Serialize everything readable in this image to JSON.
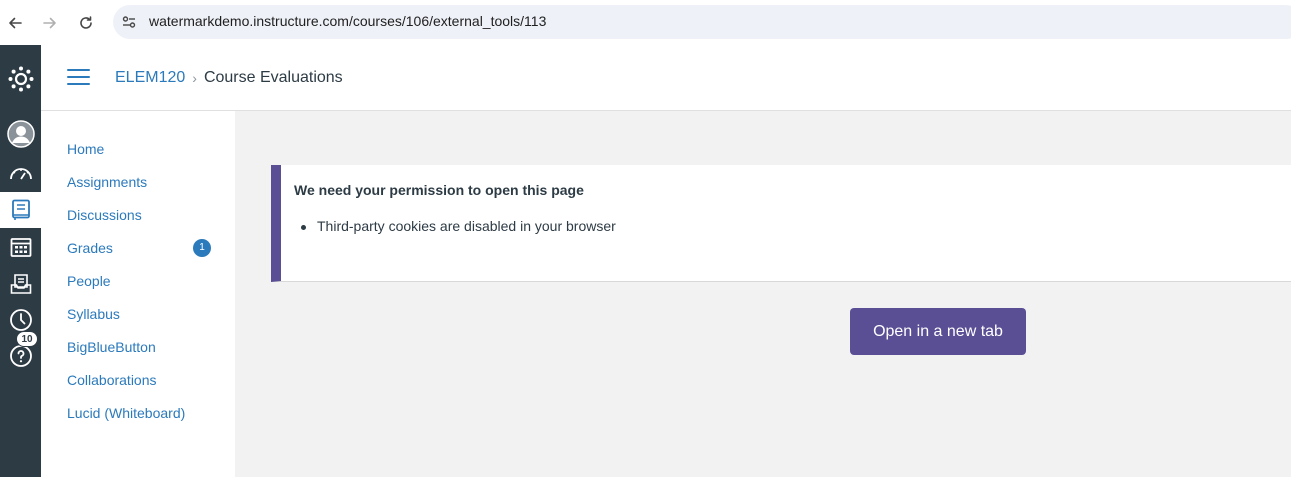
{
  "browser": {
    "url": "watermarkdemo.instructure.com/courses/106/external_tools/113"
  },
  "global_nav": {
    "items": [
      {
        "icon": "canvas-logo-icon"
      },
      {
        "icon": "account-avatar-icon"
      },
      {
        "icon": "dashboard-icon"
      },
      {
        "icon": "courses-icon",
        "active": true
      },
      {
        "icon": "calendar-icon"
      },
      {
        "icon": "inbox-icon"
      },
      {
        "icon": "history-icon"
      },
      {
        "icon": "help-icon",
        "badge": "10"
      }
    ],
    "help_badge": "10"
  },
  "header": {
    "course_code": "ELEM120",
    "separator": "›",
    "page_title": "Course Evaluations"
  },
  "course_nav": {
    "items": [
      {
        "label": "Home"
      },
      {
        "label": "Assignments"
      },
      {
        "label": "Discussions"
      },
      {
        "label": "Grades",
        "badge": "1"
      },
      {
        "label": "People"
      },
      {
        "label": "Syllabus"
      },
      {
        "label": "BigBlueButton"
      },
      {
        "label": "Collaborations"
      },
      {
        "label": "Lucid (Whiteboard)"
      }
    ],
    "grades_badge": "1"
  },
  "content": {
    "alert_title": "We need your permission to open this page",
    "alert_items": [
      "Third-party cookies are disabled in your browser"
    ],
    "open_button_label": "Open in a new tab"
  },
  "colors": {
    "accent": "#2b7abc",
    "nav_bg": "#2d3b45",
    "button": "#5a4e95"
  }
}
